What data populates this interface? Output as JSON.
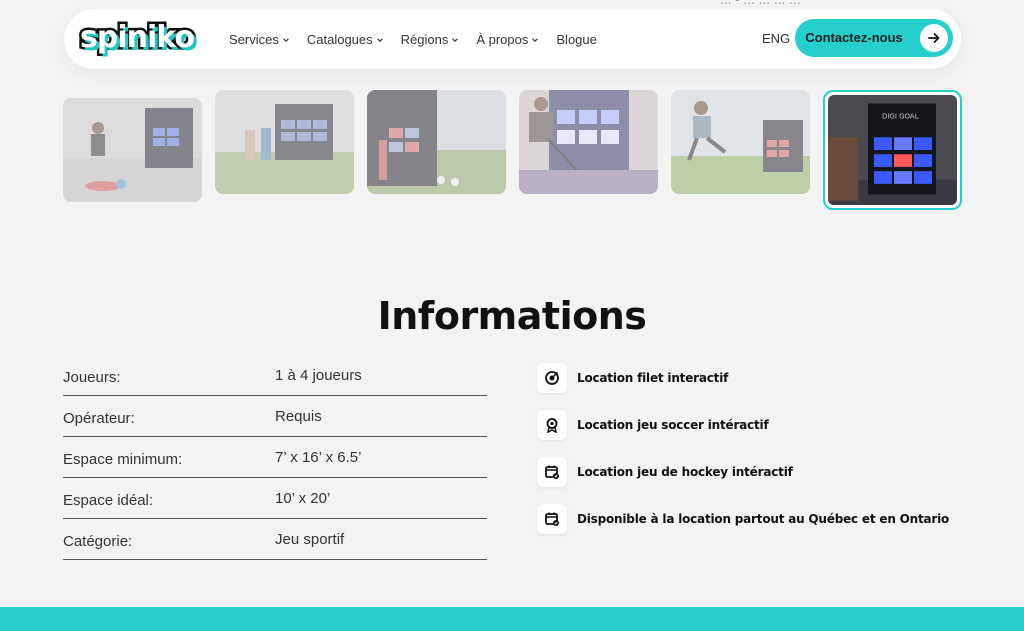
{
  "top_peek": "... - ... ... ... ...",
  "header": {
    "logo_text": "spiniko",
    "nav": [
      {
        "label": "Services",
        "has_dropdown": true
      },
      {
        "label": "Catalogues",
        "has_dropdown": true
      },
      {
        "label": "Régions",
        "has_dropdown": true
      },
      {
        "label": "À propos",
        "has_dropdown": true
      },
      {
        "label": "Blogue",
        "has_dropdown": false
      }
    ],
    "lang": "ENG",
    "cta_label": "Contactez-nous",
    "accent": "#25cfcc"
  },
  "gallery": {
    "active_index": 5,
    "thumbnails": [
      {
        "icon": "photo-soccer-kick"
      },
      {
        "icon": "photo-digi-goal-players"
      },
      {
        "icon": "photo-digi-goal-outdoor"
      },
      {
        "icon": "photo-hockey-player"
      },
      {
        "icon": "photo-soccer-jump"
      },
      {
        "icon": "photo-digi-goal-lit"
      }
    ]
  },
  "info": {
    "title": "Informations",
    "specs": [
      {
        "label": "Joueurs:",
        "value": "1 à 4 joueurs"
      },
      {
        "label": "Opérateur:",
        "value": "Requis"
      },
      {
        "label": "Espace minimum:",
        "value": "7’ x 16’ x 6.5’"
      },
      {
        "label": "Espace idéal:",
        "value": "10’ x 20’"
      },
      {
        "label": "Catégorie:",
        "value": "Jeu sportif"
      }
    ],
    "features": [
      {
        "icon": "target-icon",
        "label": "Location filet interactif"
      },
      {
        "icon": "badge-icon",
        "label": "Location jeu soccer intéractif"
      },
      {
        "icon": "calendar-check-icon",
        "label": "Location jeu de hockey intéractif"
      },
      {
        "icon": "calendar-check-icon",
        "label": "Disponible à la location partout au Québec et en Ontario"
      }
    ]
  }
}
